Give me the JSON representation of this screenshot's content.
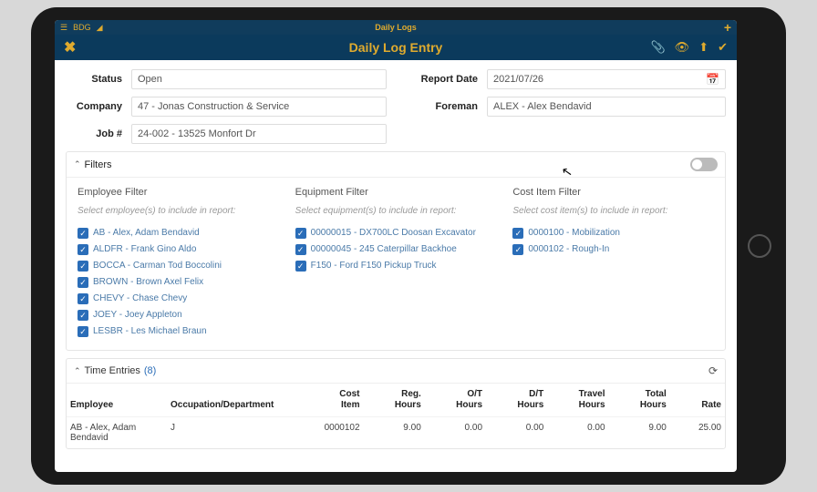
{
  "app": {
    "name": "BDG",
    "screen_title": "Daily Logs"
  },
  "modal": {
    "title": "Daily Log Entry",
    "close_glyph": "✖",
    "actions": {
      "attach": "📎",
      "view": "👁",
      "upload": "⬆",
      "confirm": "✔"
    }
  },
  "form": {
    "status": {
      "label": "Status",
      "value": "Open"
    },
    "report_date": {
      "label": "Report Date",
      "value": "2021/07/26"
    },
    "company": {
      "label": "Company",
      "value": "47 - Jonas Construction & Service"
    },
    "foreman": {
      "label": "Foreman",
      "value": "ALEX - Alex Bendavid"
    },
    "job": {
      "label": "Job #",
      "value": "24-002 - 13525 Monfort Dr"
    }
  },
  "filters": {
    "header": "Filters",
    "employee": {
      "title": "Employee Filter",
      "hint": "Select employee(s) to include in report:",
      "items": [
        "AB - Alex, Adam Bendavid",
        "ALDFR - Frank Gino Aldo",
        "BOCCA - Carman Tod Boccolini",
        "BROWN - Brown Axel Felix",
        "CHEVY - Chase Chevy",
        "JOEY - Joey Appleton",
        "LESBR - Les Michael Braun"
      ]
    },
    "equipment": {
      "title": "Equipment Filter",
      "hint": "Select equipment(s) to include in report:",
      "items": [
        "00000015 - DX700LC Doosan Excavator",
        "00000045 - 245 Caterpillar Backhoe",
        "F150 - Ford F150 Pickup Truck"
      ]
    },
    "costitem": {
      "title": "Cost Item Filter",
      "hint": "Select cost item(s) to include in report:",
      "items": [
        "0000100 - Mobilization",
        "0000102 - Rough-In"
      ]
    }
  },
  "time_entries": {
    "header": "Time Entries",
    "count": "(8)",
    "columns": {
      "employee": "Employee",
      "occupation": "Occupation/Department",
      "cost_item": "Cost Item",
      "reg": "Reg. Hours",
      "ot": "O/T Hours",
      "dt": "D/T Hours",
      "travel": "Travel Hours",
      "total": "Total Hours",
      "rate": "Rate"
    },
    "rows": [
      {
        "employee": "AB - Alex, Adam Bendavid",
        "occupation": "J",
        "cost_item": "0000102",
        "reg": "9.00",
        "ot": "0.00",
        "dt": "0.00",
        "travel": "0.00",
        "total": "9.00",
        "rate": "25.00"
      }
    ]
  }
}
